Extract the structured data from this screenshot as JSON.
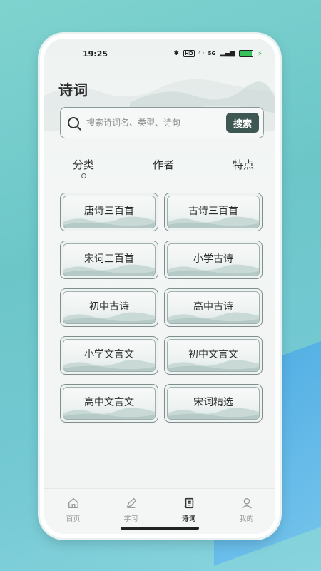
{
  "status_bar": {
    "time": "19:25",
    "network": "HD",
    "signal_text": "5G"
  },
  "page": {
    "title": "诗词"
  },
  "search": {
    "placeholder": "搜索诗词名、类型、诗句",
    "button_label": "搜索"
  },
  "tabs": [
    {
      "label": "分类",
      "active": true
    },
    {
      "label": "作者",
      "active": false
    },
    {
      "label": "特点",
      "active": false
    }
  ],
  "categories": [
    "唐诗三百首",
    "古诗三百首",
    "宋词三百首",
    "小学古诗",
    "初中古诗",
    "高中古诗",
    "小学文言文",
    "初中文言文",
    "高中文言文",
    "宋词精选"
  ],
  "bottom_nav": [
    {
      "label": "首页",
      "icon": "home-icon",
      "active": false
    },
    {
      "label": "学习",
      "icon": "pen-icon",
      "active": false
    },
    {
      "label": "诗词",
      "icon": "scroll-icon",
      "active": true
    },
    {
      "label": "我的",
      "icon": "user-icon",
      "active": false
    }
  ],
  "colors": {
    "accent": "#3e5753",
    "battery": "#36c15a"
  }
}
